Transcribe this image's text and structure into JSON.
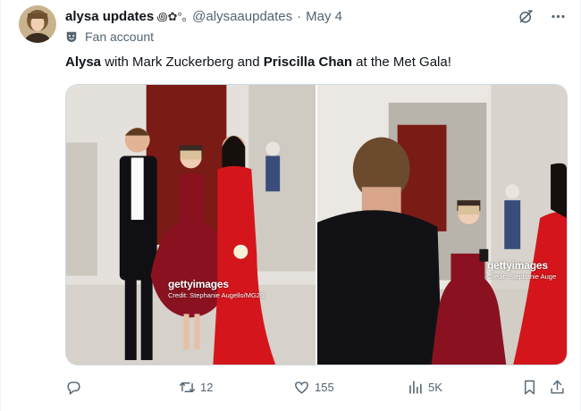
{
  "tweet": {
    "display_name": "alysa updates",
    "name_emoji": "꩜✿°｡",
    "handle": "@alysaaupdates",
    "separator": "·",
    "date": "May 4",
    "label": "Fan account",
    "text": {
      "part1": "Alysa",
      "part2": " with Mark Zuckerberg and ",
      "part3": "Priscilla Chan",
      "part4": " at the Met Gala!"
    }
  },
  "media": {
    "photo1": {
      "brand": "gettyimages",
      "credit": "Credit: Stephanie Augello/MG26"
    },
    "photo2": {
      "brand": "gettyimages",
      "credit": "Credit: Stephanie Auge"
    }
  },
  "actions": {
    "reply_count": "",
    "retweet_count": "12",
    "like_count": "155",
    "views_count": "5K"
  },
  "icons": {
    "grok": "grok-icon",
    "more": "more-icon",
    "label": "fan-account-badge-icon",
    "reply": "reply-icon",
    "retweet": "retweet-icon",
    "like": "like-icon",
    "views": "views-icon",
    "bookmark": "bookmark-icon",
    "share": "share-icon"
  },
  "colors": {
    "text_primary": "#0f1419",
    "text_secondary": "#536471",
    "dress_red": "#d4161c",
    "gown_burgundy": "#8a1220"
  }
}
